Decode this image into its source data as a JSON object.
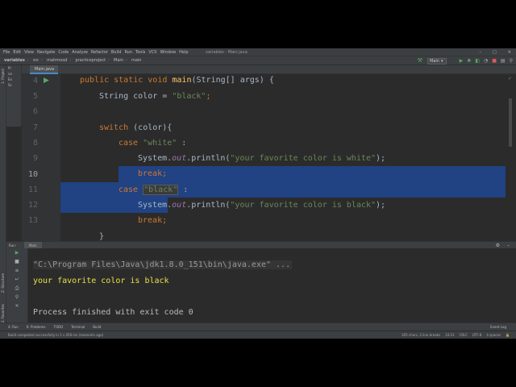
{
  "window": {
    "title": "variables - Main.java",
    "menu": [
      "File",
      "Edit",
      "View",
      "Navigate",
      "Code",
      "Analyze",
      "Refactor",
      "Build",
      "Run",
      "Tools",
      "VCS",
      "Window",
      "Help"
    ]
  },
  "breadcrumbs": [
    "variables",
    "src",
    "mahmood",
    "practiceproject",
    "Main",
    "main"
  ],
  "run_config": "Main",
  "side_tools": {
    "project": "1: Project",
    "structure": "Z: Structure",
    "favorites": "2: Favorites"
  },
  "project_tree": [
    "Pr",
    "va",
    "Ex",
    "Sc"
  ],
  "editor_tab": "Main.java",
  "editor": {
    "line_numbers": [
      "4",
      "5",
      "6",
      "7",
      "8",
      "9",
      "10",
      "11",
      "12",
      "13"
    ],
    "lines": [
      {
        "p1": "public static void ",
        "p2": "main",
        "p3": "(String[] args) {"
      },
      {
        "p1": "String color = ",
        "p2": "\"black\"",
        "p3": ";"
      },
      {
        "p1": "",
        "p2": "",
        "p3": ""
      },
      {
        "p1": "switch ",
        "p2": "",
        "p3": "(color){"
      },
      {
        "p1": "case ",
        "p2": "\"white\"",
        "p3": " :"
      },
      {
        "p1": "System.",
        "p2": "out",
        "p3": ".println(",
        "p4": "\"your favorite color is white\"",
        "p5": ");"
      },
      {
        "p1": "break",
        "p2": ";",
        "p3": ""
      },
      {
        "p1": "case ",
        "p2": "\"black\"",
        "p3": " :"
      },
      {
        "p1": "System.",
        "p2": "out",
        "p3": ".println(",
        "p4": "\"your favorite color is black\"",
        "p5": ");"
      },
      {
        "p1": "break",
        "p2": ";",
        "p3": ""
      }
    ]
  },
  "run_panel": {
    "label": "Run:",
    "tab": "Main"
  },
  "console": {
    "command": "\"C:\\Program Files\\Java\\jdk1.8.0_151\\bin\\java.exe\" ...",
    "output": "your favorite color is black",
    "finished": "Process finished with exit code 0"
  },
  "tool_windows": [
    "4: Run",
    "6: Problems",
    "TODO",
    "Terminal",
    "Build"
  ],
  "event_log": "Event Log",
  "status": {
    "message": "Build completed successfully in 1 s 458 ms (moments ago)",
    "selection": "105 chars, 2 line breaks",
    "position": "10:23",
    "line_sep": "CRLF",
    "encoding": "UTF-8",
    "indent": "4 spaces"
  },
  "colors": {
    "keyword": "#cc7832",
    "string": "#6a8759",
    "function": "#ffc66d",
    "static_field": "#9876aa",
    "selection": "#214283",
    "console_output": "#e8e04a"
  }
}
